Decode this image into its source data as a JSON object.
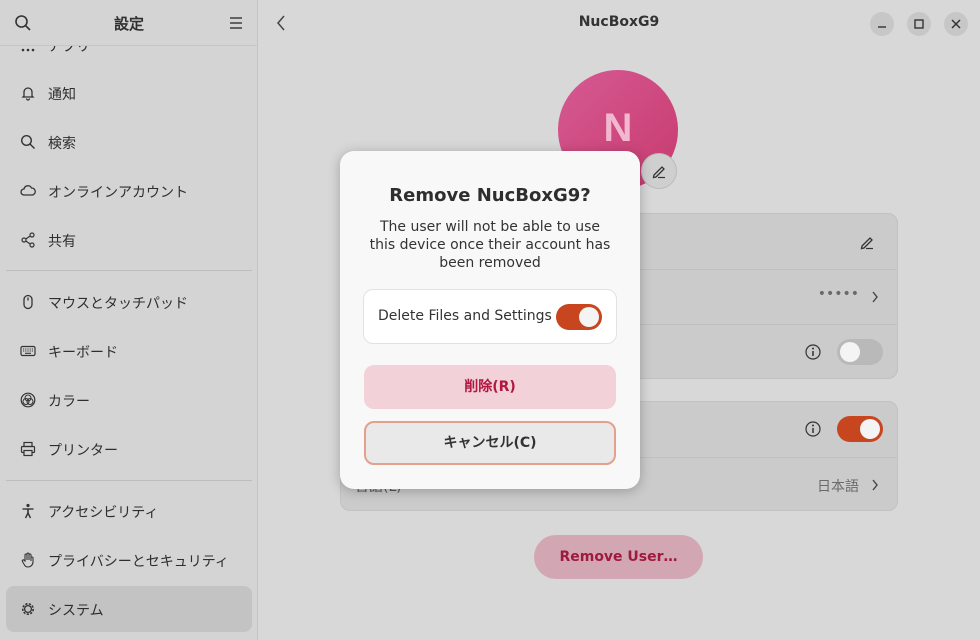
{
  "sidebar": {
    "title": "設定",
    "partial_item": "アプリ",
    "items": [
      {
        "label": "通知",
        "icon": "bell-icon"
      },
      {
        "label": "検索",
        "icon": "search-icon"
      },
      {
        "label": "オンラインアカウント",
        "icon": "cloud-icon"
      },
      {
        "label": "共有",
        "icon": "share-icon"
      },
      {
        "label": "マウスとタッチパッド",
        "icon": "mouse-icon"
      },
      {
        "label": "キーボード",
        "icon": "keyboard-icon"
      },
      {
        "label": "カラー",
        "icon": "color-icon"
      },
      {
        "label": "プリンター",
        "icon": "printer-icon"
      },
      {
        "label": "アクセシビリティ",
        "icon": "accessibility-icon"
      },
      {
        "label": "プライバシーとセキュリティ",
        "icon": "hand-icon"
      },
      {
        "label": "システム",
        "icon": "gear-icon",
        "active": true
      }
    ]
  },
  "main": {
    "title": "NucBoxG9",
    "avatar_initial": "N",
    "password_mask": "•••••",
    "language_value": "日本語",
    "language_label_partial": "言語(L)",
    "remove_user_label": "Remove User…"
  },
  "dialog": {
    "title": "Remove NucBoxG9?",
    "body": "The user will not be able to use this device once their account has been removed",
    "option_label": "Delete Files and Settings",
    "option_on": true,
    "delete_label": "削除(R)",
    "cancel_label": "キャンセル(C)"
  },
  "colors": {
    "accent": "#c7451f",
    "destructive": "#b0183f",
    "avatar": "#d04f85"
  }
}
